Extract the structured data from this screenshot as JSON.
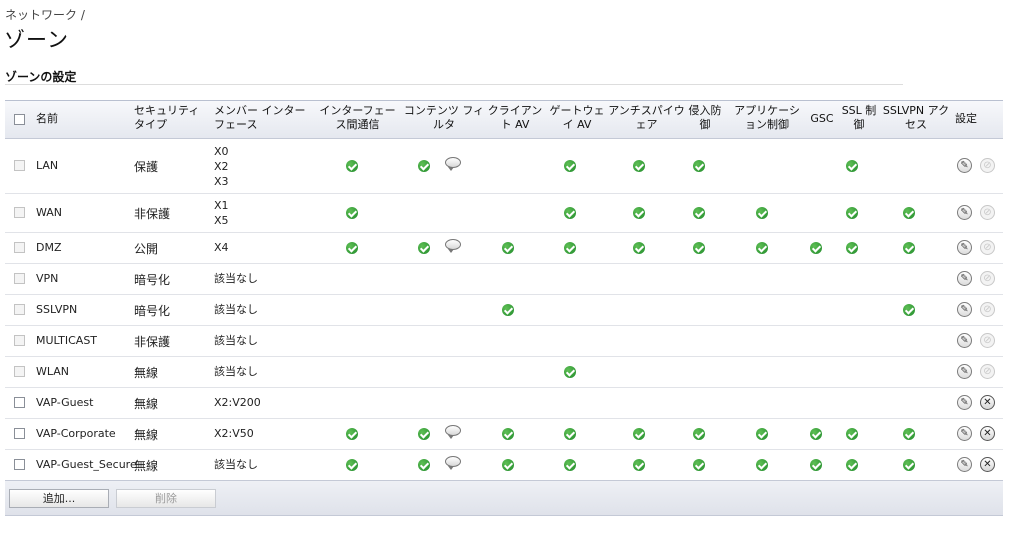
{
  "breadcrumb": "ネットワーク /",
  "page_title": "ゾーン",
  "section_title": "ゾーンの設定",
  "columns": {
    "name": "名前",
    "security": "セキュリティタイプ",
    "members": "メンバー インターフェース",
    "intra": "インターフェース間通信",
    "cfs": "コンテンツ フィルタ",
    "client_av": "クライアント AV",
    "gateway_av": "ゲートウェイ AV",
    "anti_spyware": "アンチスパイウェア",
    "ips": "侵入防御",
    "app_control": "アプリケーション制御",
    "gsc": "GSC",
    "ssl_control": "SSL 制御",
    "sslvpn_access": "SSLVPN アクセス",
    "config": "設定"
  },
  "rows": [
    {
      "name": "LAN",
      "security": "保護",
      "members": [
        "X0",
        "X2",
        "X3"
      ],
      "intra": true,
      "cfs": true,
      "cfs_bubble": true,
      "client_av": false,
      "gateway_av": true,
      "anti_spyware": true,
      "ips": true,
      "app_control": false,
      "gsc": false,
      "ssl_control": true,
      "sslvpn_access": false,
      "checkbox_enabled": false,
      "deletable": false
    },
    {
      "name": "WAN",
      "security": "非保護",
      "members": [
        "X1",
        "X5"
      ],
      "intra": true,
      "cfs": false,
      "cfs_bubble": false,
      "client_av": false,
      "gateway_av": true,
      "anti_spyware": true,
      "ips": true,
      "app_control": true,
      "gsc": false,
      "ssl_control": true,
      "sslvpn_access": true,
      "checkbox_enabled": false,
      "deletable": false
    },
    {
      "name": "DMZ",
      "security": "公開",
      "members": [
        "X4"
      ],
      "intra": true,
      "cfs": true,
      "cfs_bubble": true,
      "client_av": true,
      "gateway_av": true,
      "anti_spyware": true,
      "ips": true,
      "app_control": true,
      "gsc": true,
      "ssl_control": true,
      "sslvpn_access": true,
      "checkbox_enabled": false,
      "deletable": false
    },
    {
      "name": "VPN",
      "security": "暗号化",
      "members": [
        "該当なし"
      ],
      "intra": false,
      "cfs": false,
      "cfs_bubble": false,
      "client_av": false,
      "gateway_av": false,
      "anti_spyware": false,
      "ips": false,
      "app_control": false,
      "gsc": false,
      "ssl_control": false,
      "sslvpn_access": false,
      "checkbox_enabled": false,
      "deletable": false
    },
    {
      "name": "SSLVPN",
      "security": "暗号化",
      "members": [
        "該当なし"
      ],
      "intra": false,
      "cfs": false,
      "cfs_bubble": false,
      "client_av": true,
      "gateway_av": false,
      "anti_spyware": false,
      "ips": false,
      "app_control": false,
      "gsc": false,
      "ssl_control": false,
      "sslvpn_access": true,
      "checkbox_enabled": false,
      "deletable": false
    },
    {
      "name": "MULTICAST",
      "security": "非保護",
      "members": [
        "該当なし"
      ],
      "intra": false,
      "cfs": false,
      "cfs_bubble": false,
      "client_av": false,
      "gateway_av": false,
      "anti_spyware": false,
      "ips": false,
      "app_control": false,
      "gsc": false,
      "ssl_control": false,
      "sslvpn_access": false,
      "checkbox_enabled": false,
      "deletable": false
    },
    {
      "name": "WLAN",
      "security": "無線",
      "members": [
        "該当なし"
      ],
      "intra": false,
      "cfs": false,
      "cfs_bubble": false,
      "client_av": false,
      "gateway_av": true,
      "anti_spyware": false,
      "ips": false,
      "app_control": false,
      "gsc": false,
      "ssl_control": false,
      "sslvpn_access": false,
      "checkbox_enabled": false,
      "deletable": false
    },
    {
      "name": "VAP-Guest",
      "security": "無線",
      "members": [
        "X2:V200"
      ],
      "intra": false,
      "cfs": false,
      "cfs_bubble": false,
      "client_av": false,
      "gateway_av": false,
      "anti_spyware": false,
      "ips": false,
      "app_control": false,
      "gsc": false,
      "ssl_control": false,
      "sslvpn_access": false,
      "checkbox_enabled": true,
      "deletable": true
    },
    {
      "name": "VAP-Corporate",
      "security": "無線",
      "members": [
        "X2:V50"
      ],
      "intra": true,
      "cfs": true,
      "cfs_bubble": true,
      "client_av": true,
      "gateway_av": true,
      "anti_spyware": true,
      "ips": true,
      "app_control": true,
      "gsc": true,
      "ssl_control": true,
      "sslvpn_access": true,
      "checkbox_enabled": true,
      "deletable": true
    },
    {
      "name": "VAP-Guest_Secure",
      "security": "無線",
      "members": [
        "該当なし"
      ],
      "intra": true,
      "cfs": true,
      "cfs_bubble": true,
      "client_av": true,
      "gateway_av": true,
      "anti_spyware": true,
      "ips": true,
      "app_control": true,
      "gsc": true,
      "ssl_control": true,
      "sslvpn_access": true,
      "checkbox_enabled": true,
      "deletable": true
    }
  ],
  "buttons": {
    "add": "追加...",
    "delete": "削除"
  },
  "icons": {
    "check": "check-circle-icon",
    "bubble": "comment-bubble-icon",
    "edit": "pencil-icon",
    "delete": "delete-icon"
  },
  "colors": {
    "check_green": "#1f8a2a",
    "header_bg": "#e5e8ef"
  }
}
